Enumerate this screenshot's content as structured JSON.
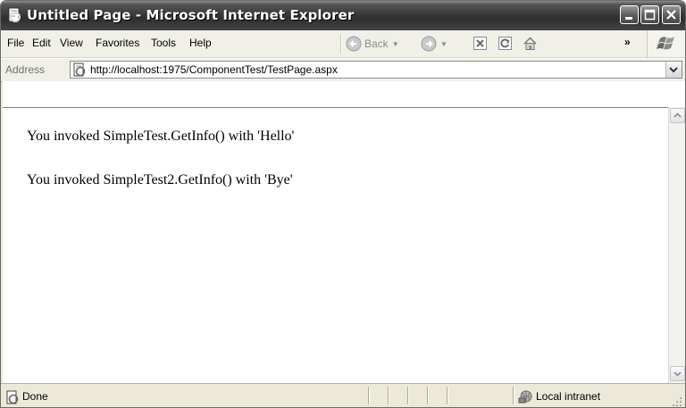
{
  "window": {
    "title": "Untitled Page - Microsoft Internet Explorer"
  },
  "menu": {
    "items": [
      "File",
      "Edit",
      "View",
      "Favorites",
      "Tools",
      "Help"
    ],
    "back_label": "Back",
    "more_label": "»"
  },
  "address": {
    "label": "Address",
    "url": "http://localhost:1975/ComponentTest/TestPage.aspx"
  },
  "page": {
    "lines": [
      "You invoked SimpleTest.GetInfo() with 'Hello'",
      "You invoked SimpleTest2.GetInfo() with 'Bye'"
    ]
  },
  "status": {
    "text": "Done",
    "zone": "Local intranet"
  },
  "icons": {
    "app": "ie-page-icon",
    "back": "back-arrow-icon",
    "forward": "forward-arrow-icon",
    "stop": "stop-icon",
    "refresh": "refresh-icon",
    "home": "home-icon",
    "windows_logo": "windows-logo-icon",
    "zone": "local-intranet-icon"
  }
}
